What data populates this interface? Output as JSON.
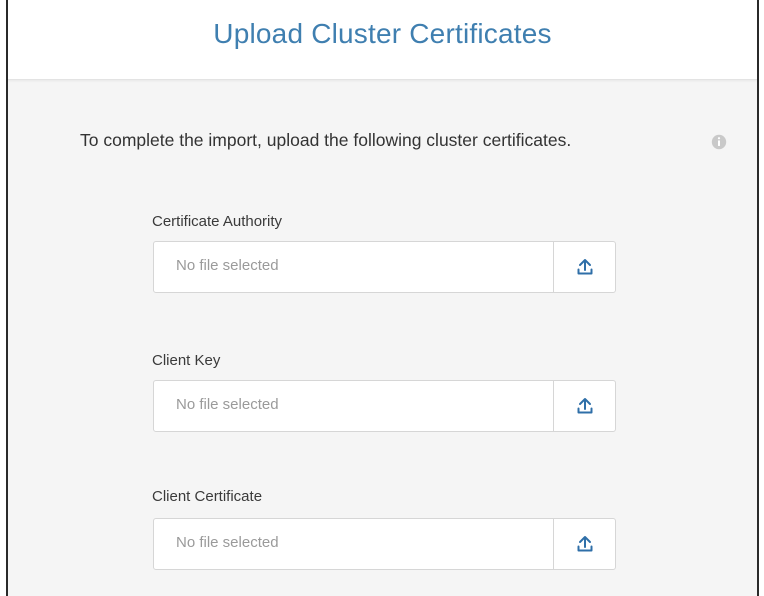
{
  "dialog": {
    "title": "Upload Cluster Certificates",
    "instruction": "To complete the import, upload the following cluster certificates."
  },
  "fields": [
    {
      "label": "Certificate Authority",
      "value": "No file selected",
      "icon": "upload-icon"
    },
    {
      "label": "Client Key",
      "value": "No file selected",
      "icon": "upload-icon"
    },
    {
      "label": "Client Certificate",
      "value": "No file selected",
      "icon": "upload-icon"
    }
  ],
  "icons": {
    "info": "info-icon",
    "upload": "upload-icon"
  },
  "colors": {
    "title": "#3f7fb0",
    "upload_icon": "#2f6fa8",
    "panel_background": "#f5f5f5"
  }
}
